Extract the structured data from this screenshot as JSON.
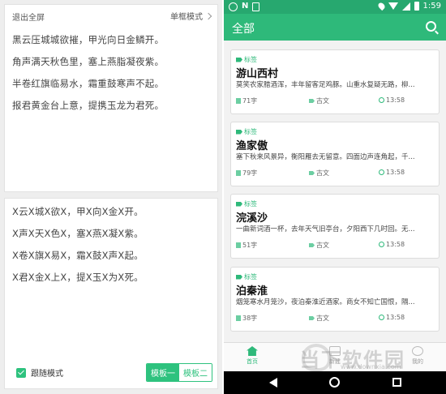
{
  "left": {
    "exit_fullscreen": "退出全屏",
    "mode_label": "单框模式",
    "poem_lines": [
      "黑云压城城欲摧，甲光向日金鳞开。",
      "角声满天秋色里，塞上燕脂凝夜紫。",
      "半卷红旗临易水，霜重鼓寒声不起。",
      "报君黄金台上意，提携玉龙为君死。"
    ],
    "masked_lines": [
      "X云X城X欲X，甲X向X金X开。",
      "X声X天X色X，塞X燕X凝X紫。",
      "X卷X旗X易X，霜X鼓X声X起。",
      "X君X金X上X，提X玉X为X死。"
    ],
    "follow_mode": "跟随模式",
    "template_one": "模板一",
    "template_two": "模板二"
  },
  "phone": {
    "status_time": "1:59",
    "status_n": "N",
    "title": "全部",
    "cards": [
      {
        "tag": "标签",
        "title": "游山西村",
        "excerpt": "莫笑农家腊酒浑，丰年留客足鸡豚。山重水复疑无路，柳...",
        "words": "71字",
        "category": "古文",
        "time": "13:58"
      },
      {
        "tag": "标签",
        "title": "渔家傲",
        "excerpt": "塞下秋来风景异，衡阳雁去无留意。四面边声连角起，千...",
        "words": "79字",
        "category": "古文",
        "time": "13:58"
      },
      {
        "tag": "标签",
        "title": "浣溪沙",
        "excerpt": "一曲新词酒一杯，去年天气旧亭台，夕阳西下几时回。无...",
        "words": "51字",
        "category": "古文",
        "time": "13:58"
      },
      {
        "tag": "标签",
        "title": "泊秦淮",
        "excerpt": "烟笼寒水月笼沙，夜泊秦淮近酒家。商女不知亡国恨，隔...",
        "words": "38字",
        "category": "古文",
        "time": "13:58"
      }
    ],
    "tabs": [
      "首页",
      "新建",
      "我的"
    ]
  },
  "watermark": {
    "text": "当下软件园",
    "url": "www.downxia.com"
  }
}
